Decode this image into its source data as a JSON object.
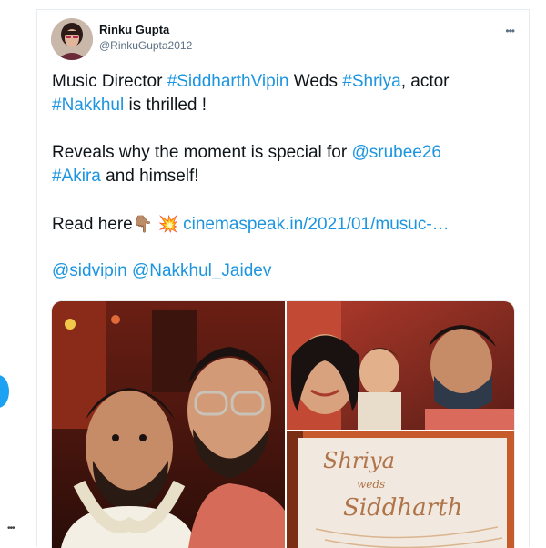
{
  "tweet": {
    "author_name": "Rinku Gupta",
    "author_handle": "@RinkuGupta2012",
    "more_icon": "•••",
    "lines": {
      "l1_a": "Music Director ",
      "l1_b": "#SiddharthVipin",
      "l1_c": " Weds ",
      "l1_d": "#Shriya",
      "l1_e": ", actor",
      "l2_a": "#Nakkhul",
      "l2_b": " is thrilled !",
      "l3_a": "Reveals why the moment is special for ",
      "l3_b": "@srubee26",
      "l4_a": "#Akira",
      "l4_b": " and himself!",
      "l5_a": "Read here",
      "l5_emoji1": "👇🏽",
      "l5_emoji2": "💥",
      "l5_link": "cinemaspeak.in/2021/01/musuc-…",
      "l6_a": "@sidvipin",
      "l6_b": "@Nakkhul_Jaidev"
    },
    "media": {
      "invite_line1": "Shriya",
      "invite_line2": "weds",
      "invite_line3": "Siddharth"
    }
  },
  "sidebar": {
    "more_icon": "•••"
  },
  "colors": {
    "link": "#1b95e0",
    "text": "#0f1419",
    "secondary": "#5b7083"
  }
}
